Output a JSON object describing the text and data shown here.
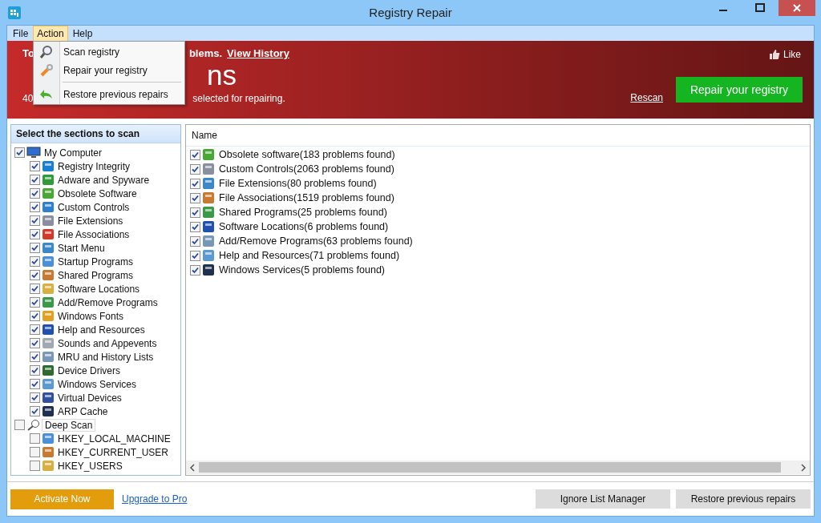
{
  "window": {
    "title": "Registry Repair"
  },
  "menu_bar": [
    {
      "label": "File",
      "selected": false
    },
    {
      "label": "Action",
      "selected": true
    },
    {
      "label": "Help",
      "selected": false
    }
  ],
  "action_menu": [
    {
      "label": "Scan registry"
    },
    {
      "label": "Repair your registry"
    },
    {
      "label": "Restore previous repairs"
    }
  ],
  "banner": {
    "line_start": "To",
    "line_end": "blems.",
    "history_link": "View History",
    "big_end": "ns",
    "summary_start": "40",
    "summary_end": "selected for repairing.",
    "like": "Like",
    "rescan": "Rescan",
    "repair_button": "Repair your registry"
  },
  "sections_panel": {
    "title": "Select the sections to scan",
    "tree": [
      {
        "label": "My Computer",
        "checked": true,
        "selected": false,
        "children": [
          {
            "label": "Registry Integrity",
            "checked": true
          },
          {
            "label": "Adware and Spyware",
            "checked": true
          },
          {
            "label": "Obsolete Software",
            "checked": true
          },
          {
            "label": "Custom Controls",
            "checked": true
          },
          {
            "label": "File Extensions",
            "checked": true
          },
          {
            "label": "File Associations",
            "checked": true
          },
          {
            "label": "Start Menu",
            "checked": true
          },
          {
            "label": "Startup Programs",
            "checked": true
          },
          {
            "label": "Shared Programs",
            "checked": true
          },
          {
            "label": "Software Locations",
            "checked": true
          },
          {
            "label": "Add/Remove Programs",
            "checked": true
          },
          {
            "label": "Windows Fonts",
            "checked": true
          },
          {
            "label": "Help and Resources",
            "checked": true
          },
          {
            "label": "Sounds and Appevents",
            "checked": true
          },
          {
            "label": "MRU and History Lists",
            "checked": true
          },
          {
            "label": "Device Drivers",
            "checked": true
          },
          {
            "label": "Windows Services",
            "checked": true
          },
          {
            "label": "Virtual Devices",
            "checked": true
          },
          {
            "label": "ARP Cache",
            "checked": true
          }
        ]
      },
      {
        "label": "Deep Scan",
        "checked": false,
        "selected": true,
        "children": [
          {
            "label": "HKEY_LOCAL_MACHINE",
            "checked": false
          },
          {
            "label": "HKEY_CURRENT_USER",
            "checked": false
          },
          {
            "label": "HKEY_USERS",
            "checked": false
          }
        ]
      }
    ]
  },
  "results": {
    "column": "Name",
    "rows": [
      {
        "label": "Obsolete software(183 problems found)",
        "checked": true
      },
      {
        "label": "Custom Controls(2063 problems found)",
        "checked": true
      },
      {
        "label": "File Extensions(80 problems found)",
        "checked": true
      },
      {
        "label": "File Associations(1519 problems found)",
        "checked": true
      },
      {
        "label": "Shared Programs(25 problems found)",
        "checked": true
      },
      {
        "label": "Software Locations(6 problems found)",
        "checked": true
      },
      {
        "label": "Add/Remove Programs(63 problems found)",
        "checked": true
      },
      {
        "label": "Help and Resources(71 problems found)",
        "checked": true
      },
      {
        "label": "Windows Services(5 problems found)",
        "checked": true
      }
    ]
  },
  "footer": {
    "activate": "Activate Now",
    "upgrade": "Upgrade to Pro",
    "ignore": "Ignore List Manager",
    "restore": "Restore previous repairs"
  }
}
